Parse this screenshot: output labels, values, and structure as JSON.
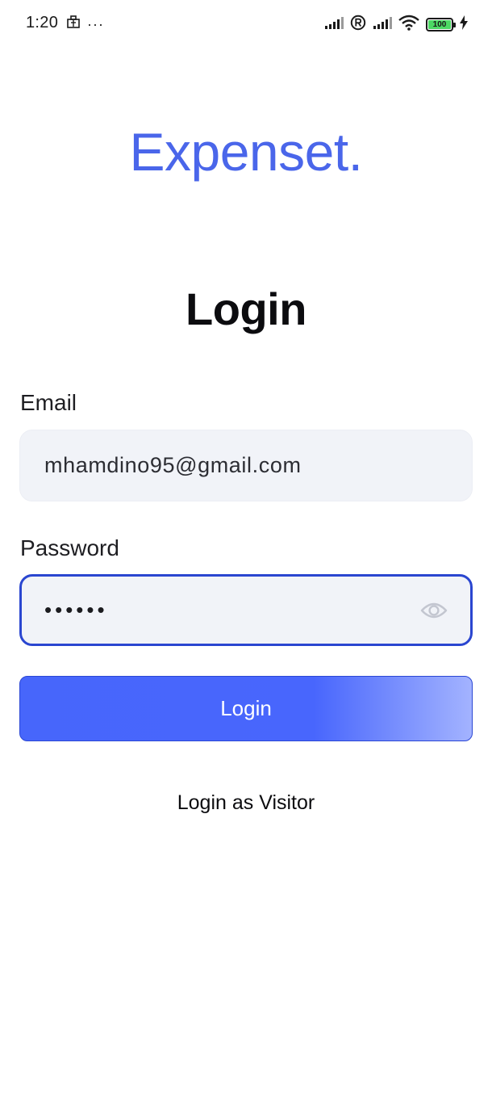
{
  "status_bar": {
    "time": "1:20",
    "more_indicator": "···",
    "battery_level": "100",
    "icons": [
      "app-notification-icon",
      "more-dots-icon",
      "signal-icon",
      "registered-icon",
      "signal-icon",
      "wifi-icon",
      "battery-icon",
      "charging-icon"
    ]
  },
  "brand": {
    "name": "Expenset."
  },
  "page": {
    "title": "Login"
  },
  "form": {
    "email_label": "Email",
    "email_value": "mhamdino95@gmail.com",
    "password_label": "Password",
    "password_mask": "••••••",
    "password_toggle_icon": "eye-icon",
    "login_label": "Login",
    "visitor_label": "Login as Visitor"
  },
  "colors": {
    "brand": "#4a66ea",
    "focus_border": "#2a46d0",
    "button": "#4866fd",
    "input_bg": "#f1f3f8"
  }
}
